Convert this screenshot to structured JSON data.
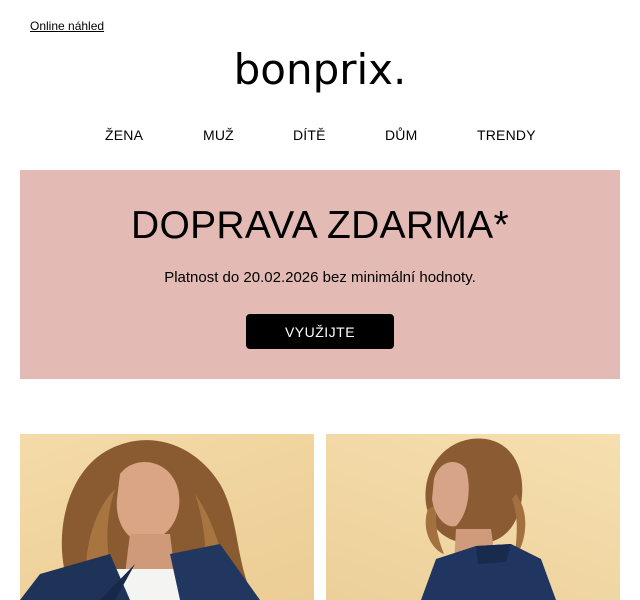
{
  "header": {
    "online_link": "Online náhled"
  },
  "logo": {
    "text": "bonprix."
  },
  "nav": [
    {
      "label": "ŽENA"
    },
    {
      "label": "MUŽ"
    },
    {
      "label": "DÍTĚ"
    },
    {
      "label": "DŮM"
    },
    {
      "label": "TRENDY"
    }
  ],
  "promo": {
    "title": "DOPRAVA ZDARMA*",
    "subtitle": "Platnost do 20.02.2026 bez minimální hodnoty.",
    "button_label": "VYUŽIJTE",
    "background_color": "#e3bbb4"
  },
  "photos": [
    {
      "name": "woman-navy-blazer-front"
    },
    {
      "name": "woman-navy-blazer-back"
    }
  ]
}
